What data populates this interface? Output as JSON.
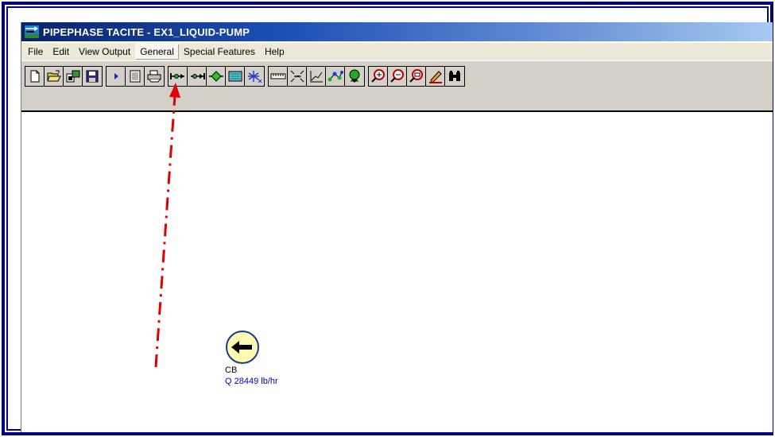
{
  "window": {
    "title": "PIPEPHASE TACITE - EX1_LIQUID-PUMP"
  },
  "menu": {
    "items": [
      {
        "label": "File"
      },
      {
        "label": "Edit"
      },
      {
        "label": "View Output"
      },
      {
        "label": "General",
        "active": true
      },
      {
        "label": "Special Features"
      },
      {
        "label": "Help"
      }
    ]
  },
  "toolbar": {
    "groups": [
      [
        "new-file-icon",
        "open-folder-icon",
        "import-icon",
        "save-icon"
      ],
      [
        "run-arrow-icon",
        "document-icon",
        "print-icon"
      ],
      [
        "source-node-icon",
        "sink-node-icon",
        "junction-node-icon",
        "calculator-icon",
        "snowflake-icon"
      ],
      [
        "ruler-icon",
        "scale-dimensions-icon",
        "plot-chart-icon",
        "network-icon",
        "globe-icon"
      ],
      [
        "zoom-in-icon",
        "zoom-out-icon",
        "zoom-fit-icon",
        "pencil-icon",
        "binoculars-icon"
      ]
    ]
  },
  "canvas": {
    "node": {
      "name": "CB",
      "flow": "Q 28449 lb/hr",
      "icon": "source-arrow-icon"
    }
  },
  "annotation": {
    "color": "#e00000",
    "style": "dash-dot arrow pointing to document toolbar button"
  },
  "colors": {
    "frame": "#000080",
    "titlebar_start": "#0a246a",
    "toolbar_bg": "#d4d0c8",
    "menubar_bg": "#ece9d8",
    "node_fill": "#fff8b0",
    "node_stroke": "#1a3a8a"
  }
}
